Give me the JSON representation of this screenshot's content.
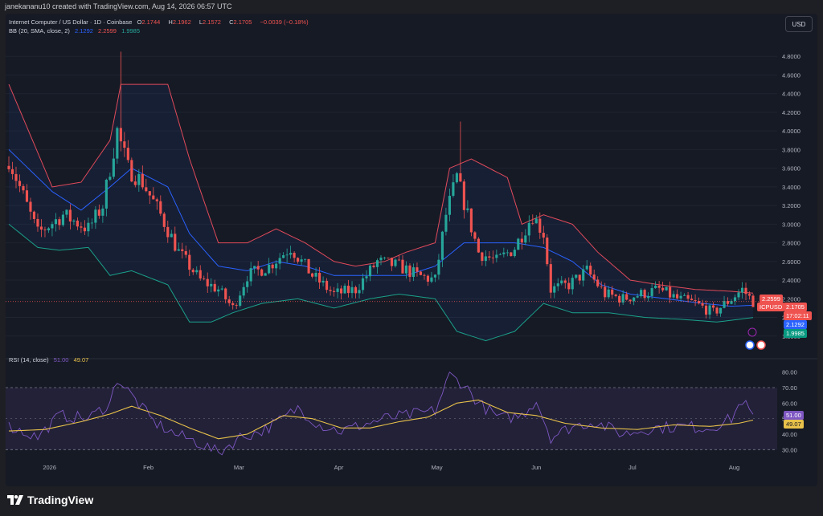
{
  "header": {
    "attribution": "janekananu10 created with TradingView.com, Aug 14, 2026 06:57 UTC"
  },
  "currency_button": "USD",
  "legend": {
    "symbol": "Internet Computer / US Dollar · 1D · Coinbase",
    "o_label": "O",
    "o": "2.1744",
    "h_label": "H",
    "h": "2.1962",
    "l_label": "L",
    "l": "2.1572",
    "c_label": "C",
    "c": "2.1705",
    "change": "−0.0039 (−0.18%)",
    "bb_label": "BB (20, SMA, close, 2)",
    "bb_basis": "2.1292",
    "bb_upper": "2.2599",
    "bb_lower": "1.9985",
    "rsi_label": "RSI (14, close)",
    "rsi_value": "51.00",
    "rsi_ma": "49.07"
  },
  "price_tags": {
    "upper": "2.2599",
    "symbol": "ICPUSD",
    "last": "2.1705",
    "countdown": "17:02:11",
    "basis": "2.1292",
    "lower": "1.9985",
    "rsi": "51.00",
    "rsi_ma": "49.07"
  },
  "footer": {
    "brand": "TradingView"
  },
  "colors": {
    "up": "#26a69a",
    "down": "#ef5350",
    "bb_upper": "#e04a5a",
    "bb_basis": "#2962ff",
    "bb_lower": "#1aa08a",
    "rsi": "#7e57c2",
    "rsi_ma": "#e8c14a"
  },
  "chart_data": [
    {
      "type": "candlestick",
      "title": "Internet Computer / US Dollar · 1D · Coinbase",
      "ylim": [
        1.6,
        5.0
      ],
      "y_ticks": [
        "1.8000",
        "2.0000",
        "2.2000",
        "2.4000",
        "2.6000",
        "2.8000",
        "3.0000",
        "3.2000",
        "3.4000",
        "3.6000",
        "3.8000",
        "4.0000",
        "4.2000",
        "4.4000",
        "4.6000",
        "4.8000"
      ],
      "x_ticks": [
        "2026",
        "Feb",
        "Mar",
        "Apr",
        "May",
        "Jun",
        "Jul",
        "Aug"
      ],
      "anchors": [
        {
          "i": 0,
          "c": 3.7
        },
        {
          "i": 8,
          "c": 2.9
        },
        {
          "i": 15,
          "c": 3.1
        },
        {
          "i": 22,
          "c": 2.95
        },
        {
          "i": 26,
          "c": 3.2
        },
        {
          "i": 30,
          "c": 4.0
        },
        {
          "i": 33,
          "c": 3.6
        },
        {
          "i": 37,
          "c": 3.45
        },
        {
          "i": 42,
          "c": 3.1
        },
        {
          "i": 47,
          "c": 2.7
        },
        {
          "i": 53,
          "c": 2.4
        },
        {
          "i": 58,
          "c": 2.3
        },
        {
          "i": 62,
          "c": 2.1
        },
        {
          "i": 66,
          "c": 2.45
        },
        {
          "i": 72,
          "c": 2.55
        },
        {
          "i": 78,
          "c": 2.75
        },
        {
          "i": 84,
          "c": 2.45
        },
        {
          "i": 90,
          "c": 2.25
        },
        {
          "i": 96,
          "c": 2.3
        },
        {
          "i": 102,
          "c": 2.6
        },
        {
          "i": 108,
          "c": 2.55
        },
        {
          "i": 113,
          "c": 2.45
        },
        {
          "i": 118,
          "c": 2.4
        },
        {
          "i": 121,
          "c": 3.1
        },
        {
          "i": 124,
          "c": 3.5
        },
        {
          "i": 127,
          "c": 3.1
        },
        {
          "i": 130,
          "c": 2.7
        },
        {
          "i": 135,
          "c": 2.6
        },
        {
          "i": 140,
          "c": 2.75
        },
        {
          "i": 145,
          "c": 3.1
        },
        {
          "i": 148,
          "c": 2.9
        },
        {
          "i": 150,
          "c": 2.3
        },
        {
          "i": 155,
          "c": 2.35
        },
        {
          "i": 160,
          "c": 2.5
        },
        {
          "i": 165,
          "c": 2.25
        },
        {
          "i": 170,
          "c": 2.2
        },
        {
          "i": 175,
          "c": 2.25
        },
        {
          "i": 180,
          "c": 2.3
        },
        {
          "i": 185,
          "c": 2.2
        },
        {
          "i": 190,
          "c": 2.15
        },
        {
          "i": 195,
          "c": 2.05
        },
        {
          "i": 200,
          "c": 2.2
        },
        {
          "i": 203,
          "c": 2.3
        },
        {
          "i": 206,
          "c": 2.17
        }
      ],
      "bb_upper_anchors": [
        [
          0,
          4.5
        ],
        [
          12,
          3.4
        ],
        [
          20,
          3.45
        ],
        [
          28,
          3.9
        ],
        [
          31,
          4.5
        ],
        [
          44,
          4.5
        ],
        [
          50,
          3.7
        ],
        [
          58,
          2.8
        ],
        [
          66,
          2.8
        ],
        [
          74,
          2.95
        ],
        [
          82,
          2.8
        ],
        [
          90,
          2.6
        ],
        [
          96,
          2.55
        ],
        [
          104,
          2.6
        ],
        [
          110,
          2.7
        ],
        [
          118,
          2.8
        ],
        [
          122,
          3.6
        ],
        [
          128,
          3.7
        ],
        [
          138,
          3.5
        ],
        [
          142,
          3.0
        ],
        [
          148,
          3.1
        ],
        [
          156,
          3.0
        ],
        [
          163,
          2.7
        ],
        [
          172,
          2.4
        ],
        [
          180,
          2.35
        ],
        [
          190,
          2.3
        ],
        [
          200,
          2.28
        ],
        [
          206,
          2.26
        ]
      ],
      "bb_basis_anchors": [
        [
          0,
          3.8
        ],
        [
          12,
          3.35
        ],
        [
          20,
          3.15
        ],
        [
          28,
          3.4
        ],
        [
          34,
          3.6
        ],
        [
          44,
          3.4
        ],
        [
          50,
          2.9
        ],
        [
          58,
          2.55
        ],
        [
          66,
          2.5
        ],
        [
          74,
          2.6
        ],
        [
          82,
          2.55
        ],
        [
          90,
          2.45
        ],
        [
          100,
          2.45
        ],
        [
          110,
          2.45
        ],
        [
          118,
          2.55
        ],
        [
          126,
          2.8
        ],
        [
          140,
          2.8
        ],
        [
          148,
          2.75
        ],
        [
          156,
          2.6
        ],
        [
          164,
          2.35
        ],
        [
          172,
          2.25
        ],
        [
          182,
          2.2
        ],
        [
          192,
          2.15
        ],
        [
          200,
          2.12
        ],
        [
          206,
          2.13
        ]
      ],
      "bb_lower_anchors": [
        [
          0,
          3.0
        ],
        [
          8,
          2.75
        ],
        [
          14,
          2.72
        ],
        [
          22,
          2.75
        ],
        [
          28,
          2.45
        ],
        [
          34,
          2.5
        ],
        [
          44,
          2.35
        ],
        [
          50,
          1.95
        ],
        [
          56,
          1.95
        ],
        [
          62,
          2.05
        ],
        [
          70,
          2.15
        ],
        [
          80,
          2.2
        ],
        [
          90,
          2.1
        ],
        [
          100,
          2.2
        ],
        [
          108,
          2.25
        ],
        [
          118,
          2.2
        ],
        [
          124,
          1.85
        ],
        [
          132,
          1.75
        ],
        [
          140,
          1.85
        ],
        [
          148,
          2.15
        ],
        [
          156,
          2.05
        ],
        [
          166,
          2.05
        ],
        [
          176,
          2.0
        ],
        [
          186,
          1.98
        ],
        [
          196,
          1.95
        ],
        [
          206,
          1.9985
        ]
      ]
    },
    {
      "type": "line",
      "title": "RSI (14, close)",
      "ylim": [
        25,
        85
      ],
      "y_ticks": [
        "30.00",
        "40.00",
        "50.00",
        "60.00",
        "70.00",
        "80.00"
      ],
      "bands": [
        30,
        70
      ],
      "rsi_anchors": [
        [
          0,
          45
        ],
        [
          8,
          38
        ],
        [
          14,
          52
        ],
        [
          22,
          50
        ],
        [
          28,
          60
        ],
        [
          30,
          76
        ],
        [
          34,
          65
        ],
        [
          40,
          48
        ],
        [
          46,
          40
        ],
        [
          52,
          35
        ],
        [
          58,
          28
        ],
        [
          64,
          38
        ],
        [
          70,
          42
        ],
        [
          76,
          50
        ],
        [
          80,
          57
        ],
        [
          86,
          46
        ],
        [
          92,
          42
        ],
        [
          98,
          46
        ],
        [
          104,
          50
        ],
        [
          110,
          52
        ],
        [
          118,
          55
        ],
        [
          122,
          78
        ],
        [
          126,
          72
        ],
        [
          130,
          60
        ],
        [
          136,
          50
        ],
        [
          142,
          52
        ],
        [
          146,
          62
        ],
        [
          150,
          38
        ],
        [
          156,
          45
        ],
        [
          162,
          48
        ],
        [
          170,
          40
        ],
        [
          178,
          44
        ],
        [
          186,
          45
        ],
        [
          194,
          44
        ],
        [
          200,
          50
        ],
        [
          203,
          62
        ],
        [
          206,
          51
        ]
      ],
      "rsi_ma_anchors": [
        [
          0,
          42
        ],
        [
          10,
          43
        ],
        [
          20,
          48
        ],
        [
          28,
          53
        ],
        [
          34,
          58
        ],
        [
          42,
          52
        ],
        [
          50,
          44
        ],
        [
          58,
          37
        ],
        [
          66,
          40
        ],
        [
          76,
          52
        ],
        [
          84,
          50
        ],
        [
          92,
          44
        ],
        [
          100,
          44
        ],
        [
          108,
          48
        ],
        [
          116,
          51
        ],
        [
          124,
          60
        ],
        [
          130,
          62
        ],
        [
          138,
          54
        ],
        [
          146,
          52
        ],
        [
          154,
          47
        ],
        [
          164,
          44
        ],
        [
          174,
          43
        ],
        [
          184,
          46
        ],
        [
          194,
          45
        ],
        [
          202,
          47
        ],
        [
          206,
          49.07
        ]
      ]
    }
  ]
}
